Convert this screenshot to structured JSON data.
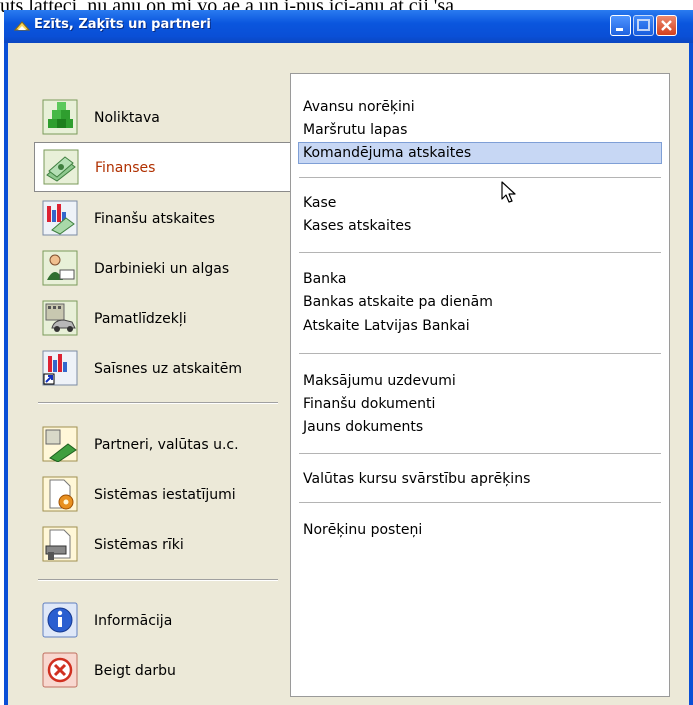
{
  "background_text": "uts latteci, nu anu on mi vo ae a un i-pus ici-anu at cij 'sa",
  "window": {
    "title": "Ezīts, Zaķīts un partneri",
    "title_icon": "app-icon",
    "controls": [
      "minimize",
      "maximize",
      "close"
    ]
  },
  "left_menu": {
    "groups": [
      [
        {
          "label": "Noliktava",
          "icon": "warehouse-icon",
          "selected": false
        },
        {
          "label": "Finanses",
          "icon": "money-icon",
          "selected": true
        },
        {
          "label": "Finanšu atskaites",
          "icon": "finance-report-icon",
          "selected": false
        },
        {
          "label": "Darbinieki un algas",
          "icon": "employee-icon",
          "selected": false
        },
        {
          "label": "Pamatlīdzekļi",
          "icon": "fixed-assets-icon",
          "selected": false
        },
        {
          "label": "Saīsnes uz atskaitēm",
          "icon": "report-shortcut-icon",
          "selected": false
        }
      ],
      [
        {
          "label": "Partneri, valūtas u.c.",
          "icon": "partners-icon",
          "selected": false
        },
        {
          "label": "Sistēmas iestatījumi",
          "icon": "settings-icon",
          "selected": false
        },
        {
          "label": "Sistēmas rīki",
          "icon": "tools-icon",
          "selected": false
        }
      ],
      [
        {
          "label": "Informācija",
          "icon": "info-icon",
          "selected": false
        },
        {
          "label": "Beigt darbu",
          "icon": "exit-icon",
          "selected": false
        }
      ]
    ]
  },
  "right_menu": {
    "groups": [
      [
        "Avansu norēķini",
        "Maršrutu lapas",
        "Komandējuma atskaites"
      ],
      [
        "Kase",
        "Kases atskaites"
      ],
      [
        "Banka",
        "Bankas atskaite pa dienām",
        "Atskaite Latvijas Bankai"
      ],
      [
        "Maksājumu uzdevumi",
        "Finanšu dokumenti",
        "Jauns dokuments"
      ],
      [
        "Valūtas kursu svārstību aprēķins"
      ],
      [
        "Norēķinu posteņi"
      ]
    ],
    "highlighted": "Komandējuma atskaites"
  },
  "colors": {
    "titlebar": "#0a4fd6",
    "client_bg": "#ece9d8",
    "selected_label": "#b03000",
    "hover_bg": "#c7d7f4"
  }
}
